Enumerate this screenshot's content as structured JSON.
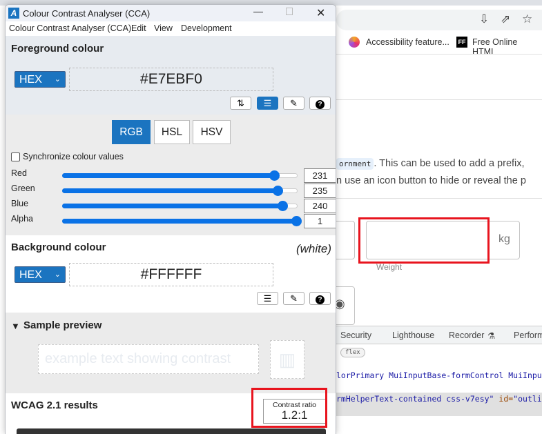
{
  "browser": {
    "toolbar_icons": [
      "install-icon",
      "share-icon",
      "star-icon"
    ],
    "bookmarks": [
      {
        "label": "Accessibility feature...",
        "icon": "firefox-logo-icon"
      },
      {
        "label": "Free Online HTML",
        "icon": "ff-logo-icon",
        "icon_text": "FF"
      }
    ],
    "page": {
      "code_snippet": "ornment",
      "line1": ". This can be used to add a prefix,",
      "line2": "n use an icon button to hide or reveal the p",
      "weight_adornment": "kg",
      "weight_helper": "Weight"
    },
    "devtools": {
      "tabs": [
        "Security",
        "Lighthouse",
        "Recorder",
        "Perform"
      ],
      "badge": "flex",
      "code_line1": "lorPrimary MuiInputBase-formControl MuiInputB",
      "code_line2_class": "rmHelperText-contained css-v7esy\"",
      "code_line2_attr": " id=",
      "code_line2_val": "\"outline"
    }
  },
  "cca": {
    "title": "Colour Contrast Analyser (CCA)",
    "menu": [
      "Colour Contrast Analyser (CCA)",
      "Edit",
      "View",
      "Development"
    ],
    "foreground": {
      "heading": "Foreground colour",
      "format": "HEX",
      "value": "#E7EBF0",
      "color": "#E7EBF0",
      "tools": [
        "swap-icon",
        "sliders-icon",
        "eyedropper-icon",
        "help-icon"
      ],
      "modes": [
        "RGB",
        "HSL",
        "HSV"
      ],
      "active_mode": "RGB",
      "sync_label": "Synchronize colour values",
      "sync_checked": false,
      "channels": [
        {
          "label": "Red",
          "value": "231",
          "fraction": 0.906
        },
        {
          "label": "Green",
          "value": "235",
          "fraction": 0.922
        },
        {
          "label": "Blue",
          "value": "240",
          "fraction": 0.941
        },
        {
          "label": "Alpha",
          "value": "1",
          "fraction": 1.0
        }
      ]
    },
    "background": {
      "heading": "Background colour",
      "name": "(white)",
      "format": "HEX",
      "value": "#FFFFFF",
      "color": "#FFFFFF"
    },
    "sample": {
      "heading": "Sample preview",
      "text": "example text showing contrast"
    },
    "wcag": {
      "heading": "WCAG 2.1 results",
      "ratio_label": "Contrast ratio",
      "ratio": "1.2:1"
    },
    "accent": "#1B74C0"
  }
}
